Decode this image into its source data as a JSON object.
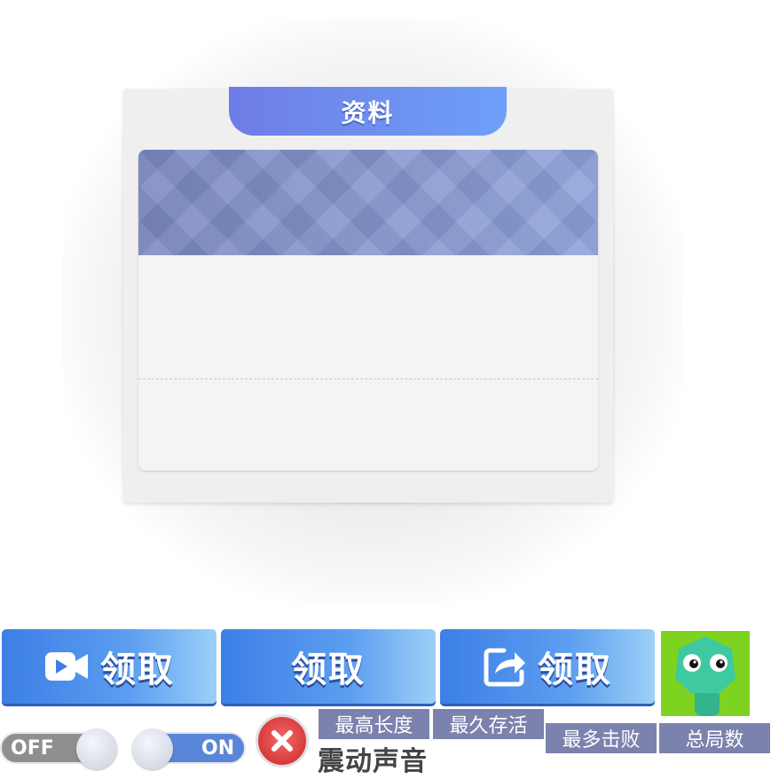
{
  "dialog": {
    "title": "资料"
  },
  "buttons": [
    {
      "label": "领取",
      "icon": "video-camera-icon"
    },
    {
      "label": "领取",
      "icon": ""
    },
    {
      "label": "领取",
      "icon": "share-icon"
    }
  ],
  "toggles": {
    "off_label": "OFF",
    "on_label": "ON"
  },
  "tags": {
    "max_length": "最高长度",
    "longest_survival": "最久存活",
    "most_kills": "最多击败",
    "total_games": "总局数"
  },
  "shake_sound": "震动声音",
  "colors": {
    "title_tab": "#6f7de6",
    "button_blue": "#3c7fe6",
    "avatar_bg": "#7ed321",
    "snake_green": "#3fc9a0",
    "tag_bg": "#7b82ad",
    "close_red": "#d83a3a"
  }
}
